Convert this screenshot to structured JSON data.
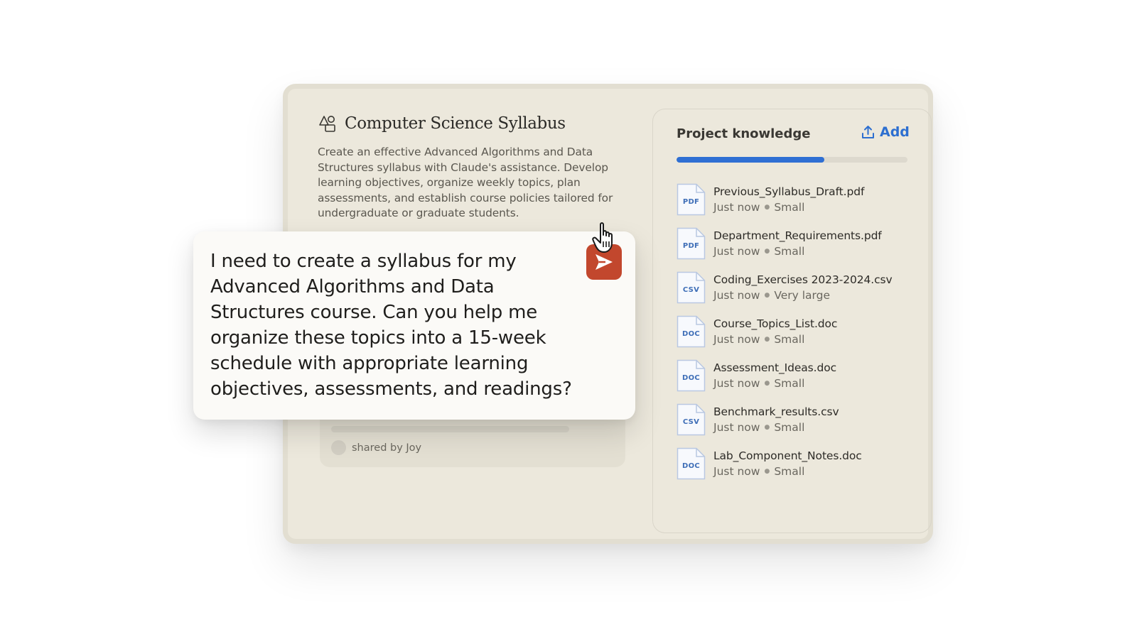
{
  "project": {
    "title": "Computer Science Syllabus",
    "icon": "project-shapes-icon",
    "description": "Create an effective Advanced Algorithms and Data Structures syllabus with Claude's assistance. Develop learning objectives, organize weekly topics, plan assessments, and establish course policies tailored for undergraduate or graduate students."
  },
  "conversation": {
    "shared_by": "shared by Joy"
  },
  "prompt": {
    "text": "I need to create a syllabus for my Advanced Algorithms and Data Structures course. Can you help me organize these topics into a 15-week schedule with appropriate learning objectives, assessments, and readings?",
    "send_icon": "send-arrow-icon"
  },
  "knowledge": {
    "title": "Project knowledge",
    "add_label": "Add",
    "usage_fraction": 0.64,
    "files": [
      {
        "name": "Previous_Syllabus_Draft.pdf",
        "type": "PDF",
        "time": "Just now",
        "size": "Small"
      },
      {
        "name": "Department_Requirements.pdf",
        "type": "PDF",
        "time": "Just now",
        "size": "Small"
      },
      {
        "name": "Coding_Exercises 2023-2024.csv",
        "type": "CSV",
        "time": "Just now",
        "size": "Very large"
      },
      {
        "name": "Course_Topics_List.doc",
        "type": "DOC",
        "time": "Just now",
        "size": "Small"
      },
      {
        "name": "Assessment_Ideas.doc",
        "type": "DOC",
        "time": "Just now",
        "size": "Small"
      },
      {
        "name": "Benchmark_results.csv",
        "type": "CSV",
        "time": "Just now",
        "size": "Small"
      },
      {
        "name": "Lab_Component_Notes.doc",
        "type": "DOC",
        "time": "Just now",
        "size": "Small"
      }
    ]
  },
  "colors": {
    "card_bg": "#ECE8DC",
    "accent_blue": "#2F6FD3",
    "send_button": "#C2472D"
  }
}
